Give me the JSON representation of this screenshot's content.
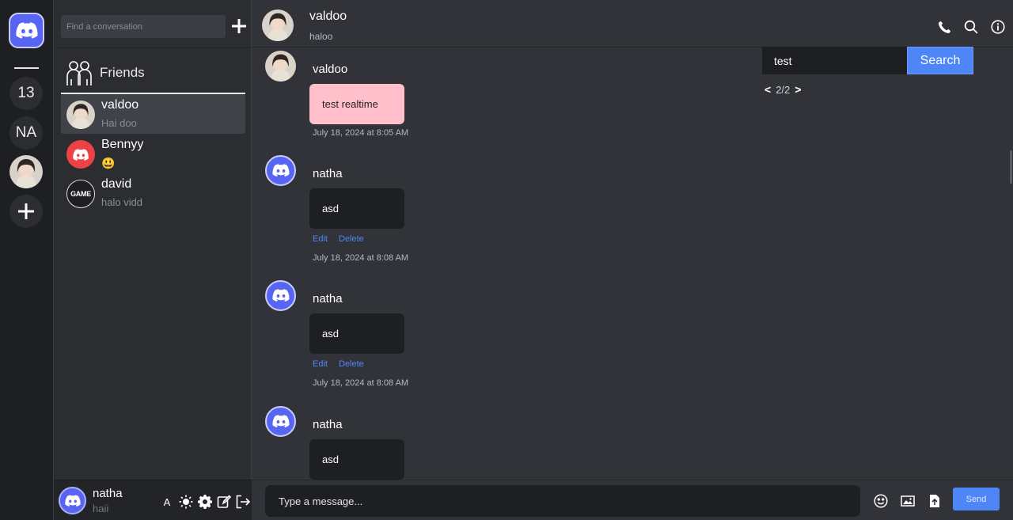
{
  "rail": {
    "servers": [
      {
        "label": "13"
      },
      {
        "label": "NA"
      }
    ],
    "add_label": "+"
  },
  "sidebar": {
    "search_placeholder": "Find a conversation",
    "add_label": "+",
    "friends_label": "Friends",
    "dms": [
      {
        "name": "valdoo",
        "preview": "Hai doo",
        "active": true
      },
      {
        "name": "Bennyy",
        "preview": "😃",
        "active": false
      },
      {
        "name": "david",
        "preview": "halo vidd",
        "active": false,
        "avatar_text": "GAME"
      }
    ]
  },
  "user_panel": {
    "name": "natha",
    "status": "haii",
    "font_toggle": "A"
  },
  "header": {
    "name": "valdoo",
    "subtitle": "haloo"
  },
  "message_search": {
    "value": "test",
    "button": "Search",
    "prev": "<",
    "count": "2/2",
    "next": ">"
  },
  "messages": [
    {
      "author": "valdoo",
      "text": "test realtime",
      "time": "July 18, 2024 at 8:05 AM",
      "own": false
    },
    {
      "author": "natha",
      "text": "asd",
      "time": "July 18, 2024 at 8:08 AM",
      "own": true
    },
    {
      "author": "natha",
      "text": "asd",
      "time": "July 18, 2024 at 8:08 AM",
      "own": true
    },
    {
      "author": "natha",
      "text": "asd",
      "time": "",
      "own": true
    }
  ],
  "actions": {
    "edit": "Edit",
    "delete": "Delete"
  },
  "composer": {
    "placeholder": "Type a message...",
    "send": "Send"
  },
  "colors": {
    "brand": "#5865f2",
    "accent": "#4f86f7",
    "bubble_pink": "#ffc0cb"
  }
}
